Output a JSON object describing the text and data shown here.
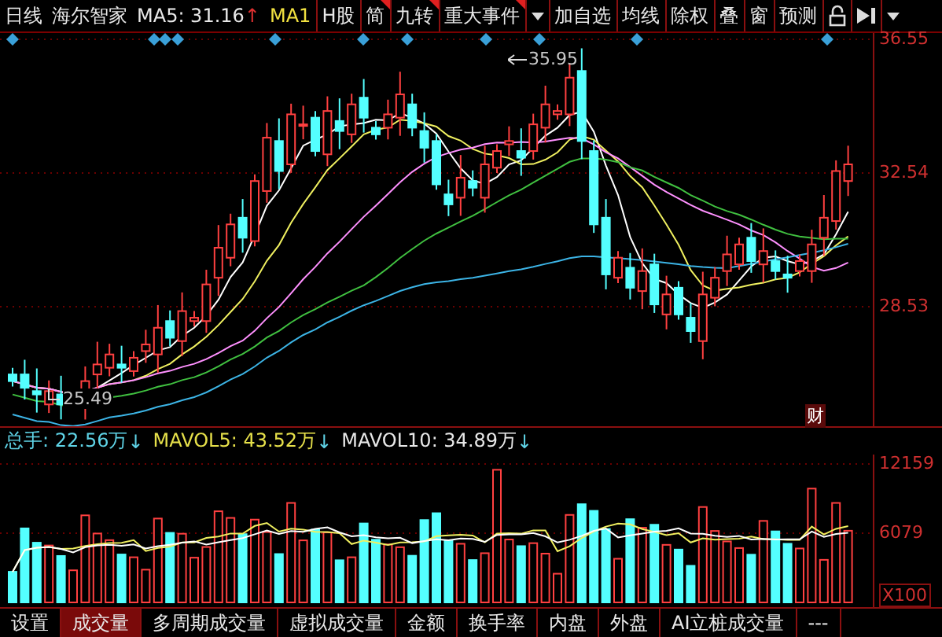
{
  "toolbar": {
    "period": "日线",
    "stock_name": "海尔智家",
    "ma_label": "MA5: 31.16",
    "ma_arrow": "↑",
    "ma_cut": "MA1",
    "buttons": [
      {
        "kind": "text",
        "label": "H股",
        "flagged": false
      },
      {
        "kind": "text",
        "label": "简",
        "flagged": true
      },
      {
        "kind": "text",
        "label": "九转",
        "flagged": true
      },
      {
        "kind": "text",
        "label": "重大事件",
        "flagged": true
      },
      {
        "kind": "dropdown"
      },
      {
        "kind": "text",
        "label": "加自选",
        "flagged": false
      },
      {
        "kind": "text",
        "label": "均线",
        "flagged": false
      },
      {
        "kind": "text",
        "label": "除权",
        "flagged": false
      },
      {
        "kind": "text",
        "label": "叠",
        "flagged": false
      },
      {
        "kind": "text",
        "label": "窗",
        "flagged": false
      },
      {
        "kind": "text",
        "label": "预测",
        "flagged": false
      },
      {
        "kind": "lock"
      },
      {
        "kind": "skip"
      },
      {
        "kind": "dropdown"
      }
    ]
  },
  "price_chart": {
    "high_marker": "35.95",
    "low_marker": "25.49",
    "badge": "财",
    "axis": [
      "36.55",
      "32.54",
      "28.53"
    ]
  },
  "volume_chart": {
    "legend": [
      {
        "label": "总手: 22.56万",
        "arrow": "↓",
        "color": "#5fd3e6"
      },
      {
        "label": "MAVOL5: 43.52万",
        "arrow": "↓",
        "color": "#e6e04a"
      },
      {
        "label": "MAVOL10: 34.89万",
        "arrow": "↓",
        "color": "#e8e8e8"
      }
    ],
    "axis": [
      "12159",
      "6079"
    ],
    "unit": "X100"
  },
  "tabs": [
    {
      "label": "设置",
      "selected": false
    },
    {
      "label": "成交量",
      "selected": true
    },
    {
      "label": "多周期成交量",
      "selected": false
    },
    {
      "label": "虚拟成交量",
      "selected": false
    },
    {
      "label": "金额",
      "selected": false
    },
    {
      "label": "换手率",
      "selected": false
    },
    {
      "label": "内盘",
      "selected": false
    },
    {
      "label": "外盘",
      "selected": false
    },
    {
      "label": "AI立桩成交量",
      "selected": false
    },
    {
      "label": "---",
      "selected": false
    }
  ]
}
